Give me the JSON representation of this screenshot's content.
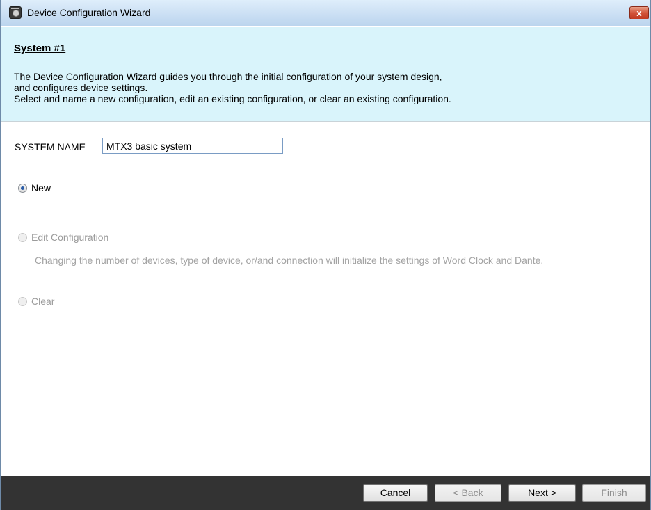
{
  "window": {
    "title": "Device Configuration Wizard",
    "close_symbol": "x"
  },
  "header": {
    "system_title": "System #1",
    "description": [
      "The Device Configuration Wizard guides you through the initial configuration of your system design,",
      "and configures device settings.",
      "Select and name a new configuration, edit an existing configuration, or clear an existing configuration."
    ]
  },
  "form": {
    "system_name_label": "SYSTEM NAME",
    "system_name_value": "MTX3 basic system",
    "options": [
      {
        "label": "New",
        "selected": true,
        "enabled": true
      },
      {
        "label": "Edit Configuration",
        "selected": false,
        "enabled": false
      },
      {
        "label": "Clear",
        "selected": false,
        "enabled": false
      }
    ],
    "edit_note": "Changing the number of devices, type of device, or/and connection will initialize the settings of Word Clock and Dante."
  },
  "footer": {
    "cancel_label": "Cancel",
    "back_label": "< Back",
    "next_label": "Next >",
    "finish_label": "Finish"
  },
  "colors": {
    "header_bg": "#d9f4fb",
    "footer_bg": "#333333",
    "close_button": "#c9472d",
    "disabled_text": "#9b9b9b"
  },
  "icons": {
    "app": "wizard-app-icon",
    "close": "close-icon"
  }
}
